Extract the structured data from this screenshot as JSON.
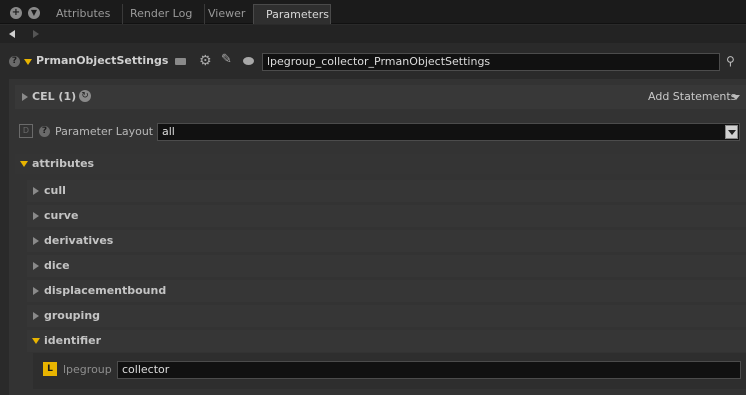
{
  "tabs": [
    {
      "label": "Attributes"
    },
    {
      "label": "Render Log"
    },
    {
      "label": "Viewer"
    },
    {
      "label": "Parameters"
    }
  ],
  "node": {
    "type_label": "PrmanObjectSettings",
    "name_value": "lpegroup_collector_PrmanObjectSettings"
  },
  "cel": {
    "label": "CEL (1)",
    "add_statements": "Add Statements"
  },
  "parameter_layout": {
    "label": "Parameter Layout",
    "value": "all"
  },
  "attributes": {
    "label": "attributes",
    "groups": [
      {
        "label": "cull"
      },
      {
        "label": "curve"
      },
      {
        "label": "derivatives"
      },
      {
        "label": "dice"
      },
      {
        "label": "displacementbound"
      },
      {
        "label": "grouping"
      }
    ],
    "identifier": {
      "label": "identifier",
      "param_label": "lpegroup",
      "param_value": "collector",
      "badge": "L"
    }
  },
  "colors": {
    "accent": "#e8b400",
    "background": "#2a2a2a"
  }
}
